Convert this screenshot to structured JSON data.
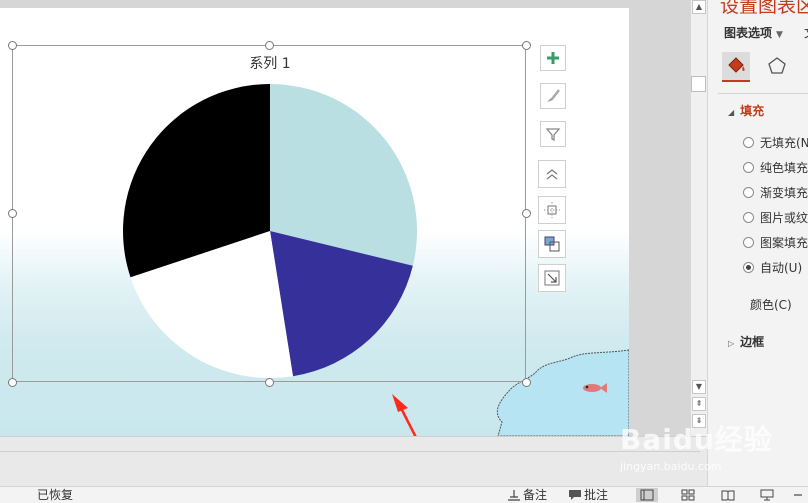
{
  "panel": {
    "title": "设置图表区",
    "options_label": "图表选项",
    "next_tab_label": "文",
    "fill_section": "填充",
    "border_section": "边框",
    "fill_options": [
      {
        "label": "无填充(N)",
        "checked": false
      },
      {
        "label": "纯色填充",
        "checked": false
      },
      {
        "label": "渐变填充",
        "checked": false
      },
      {
        "label": "图片或纹",
        "checked": false
      },
      {
        "label": "图案填充",
        "checked": false
      },
      {
        "label": "自动(U)",
        "checked": true
      }
    ],
    "color_label": "颜色(C)"
  },
  "chart_data": {
    "type": "pie",
    "title": "系列 1",
    "slices": [
      {
        "value": 28.8,
        "color": "#b9dfe3"
      },
      {
        "value": 18.7,
        "color": "#36309a"
      },
      {
        "value": 22.4,
        "color": "#ffffff"
      },
      {
        "value": 30.1,
        "color": "#000000"
      }
    ]
  },
  "statusbar": {
    "status": "已恢复",
    "notes_label": "备注",
    "comments_label": "批注"
  },
  "watermark": {
    "brand": "Baidu经验",
    "url": "jingyan.baidu.com"
  },
  "colors": {
    "accent": "#c43b1d",
    "arrow": "#ff2a1a"
  }
}
